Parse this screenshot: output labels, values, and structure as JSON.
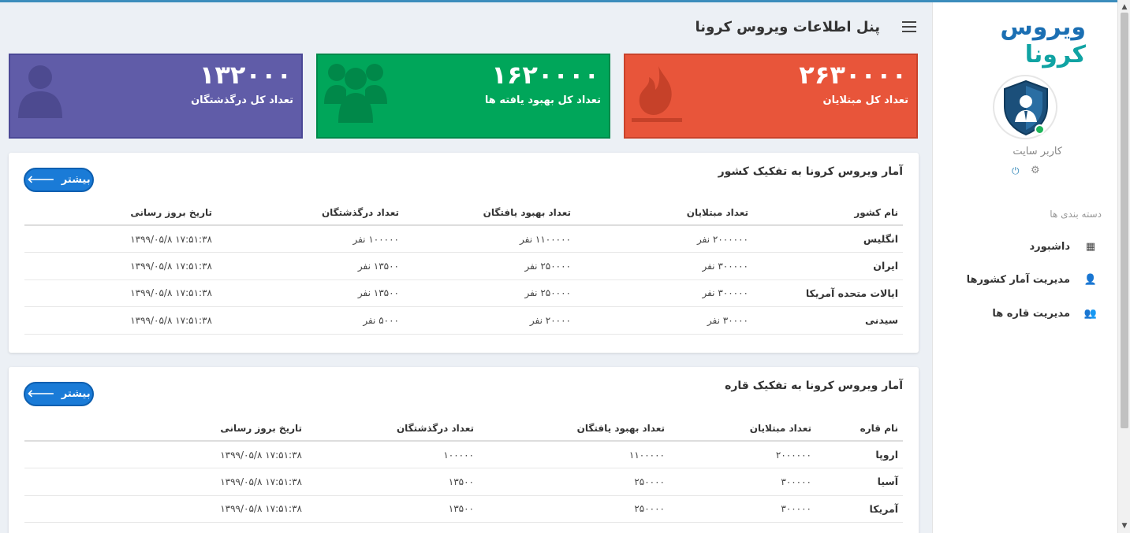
{
  "app": {
    "logo_part1": "ویروس",
    "logo_part2": "کرونا",
    "header_title": "پنل اطلاعات ویروس کرونا"
  },
  "sidebar": {
    "user_name": "کاربر سایت",
    "category_label": "دسته بندی ها",
    "items": [
      {
        "label": "داشبورد",
        "icon": "dashboard-icon"
      },
      {
        "label": "مدیریت آمار کشورها",
        "icon": "user-icon"
      },
      {
        "label": "مدیریت قاره ها",
        "icon": "users-icon"
      }
    ]
  },
  "stats": {
    "infected": {
      "value": "۲۶۳۰۰۰۰",
      "label": "تعداد کل مبتلایان"
    },
    "recovered": {
      "value": "۱۶۲۰۰۰۰",
      "label": "تعداد کل بهبود یافته ها"
    },
    "deaths": {
      "value": "۱۳۲۰۰۰",
      "label": "تعداد کل درگذشتگان"
    }
  },
  "countries": {
    "title": "آمار ویروس کرونا به تفکیک کشور",
    "more_label": "بیشتر",
    "headers": [
      "نام کشور",
      "تعداد مبتلایان",
      "تعداد بهبود یافتگان",
      "تعداد درگذشتگان",
      "تاریخ بروز رسانی"
    ],
    "rows": [
      [
        "انگلیس",
        "۲۰۰۰۰۰۰ نفر",
        "۱۱۰۰۰۰۰ نفر",
        "۱۰۰۰۰۰ نفر",
        "۱۷:۵۱:۳۸ ۱۳۹۹/۰۵/۸"
      ],
      [
        "ایران",
        "۳۰۰۰۰۰ نفر",
        "۲۵۰۰۰۰ نفر",
        "۱۳۵۰۰ نفر",
        "۱۷:۵۱:۳۸ ۱۳۹۹/۰۵/۸"
      ],
      [
        "ایالات متحده آمریکا",
        "۳۰۰۰۰۰ نفر",
        "۲۵۰۰۰۰ نفر",
        "۱۳۵۰۰ نفر",
        "۱۷:۵۱:۳۸ ۱۳۹۹/۰۵/۸"
      ],
      [
        "سیدنی",
        "۳۰۰۰۰ نفر",
        "۲۰۰۰۰ نفر",
        "۵۰۰۰ نفر",
        "۱۷:۵۱:۳۸ ۱۳۹۹/۰۵/۸"
      ]
    ]
  },
  "continents": {
    "title": "آمار ویروس کرونا به تفکیک قاره",
    "more_label": "بیشتر",
    "headers": [
      "نام قاره",
      "تعداد مبتلایان",
      "تعداد بهبود یافتگان",
      "تعداد درگذشتگان",
      "تاریخ بروز رسانی"
    ],
    "rows": [
      [
        "اروپا",
        "۲۰۰۰۰۰۰",
        "۱۱۰۰۰۰۰",
        "۱۰۰۰۰۰",
        "۱۷:۵۱:۳۸ ۱۳۹۹/۰۵/۸"
      ],
      [
        "آسیا",
        "۳۰۰۰۰۰",
        "۲۵۰۰۰۰",
        "۱۳۵۰۰",
        "۱۷:۵۱:۳۸ ۱۳۹۹/۰۵/۸"
      ],
      [
        "آمریکا",
        "۳۰۰۰۰۰",
        "۲۵۰۰۰۰",
        "۱۳۵۰۰",
        "۱۷:۵۱:۳۸ ۱۳۹۹/۰۵/۸"
      ]
    ]
  },
  "colors": {
    "infected": "#e8553a",
    "recovered": "#00a65a",
    "deaths": "#605ca8",
    "button": "#1a7bd7"
  }
}
